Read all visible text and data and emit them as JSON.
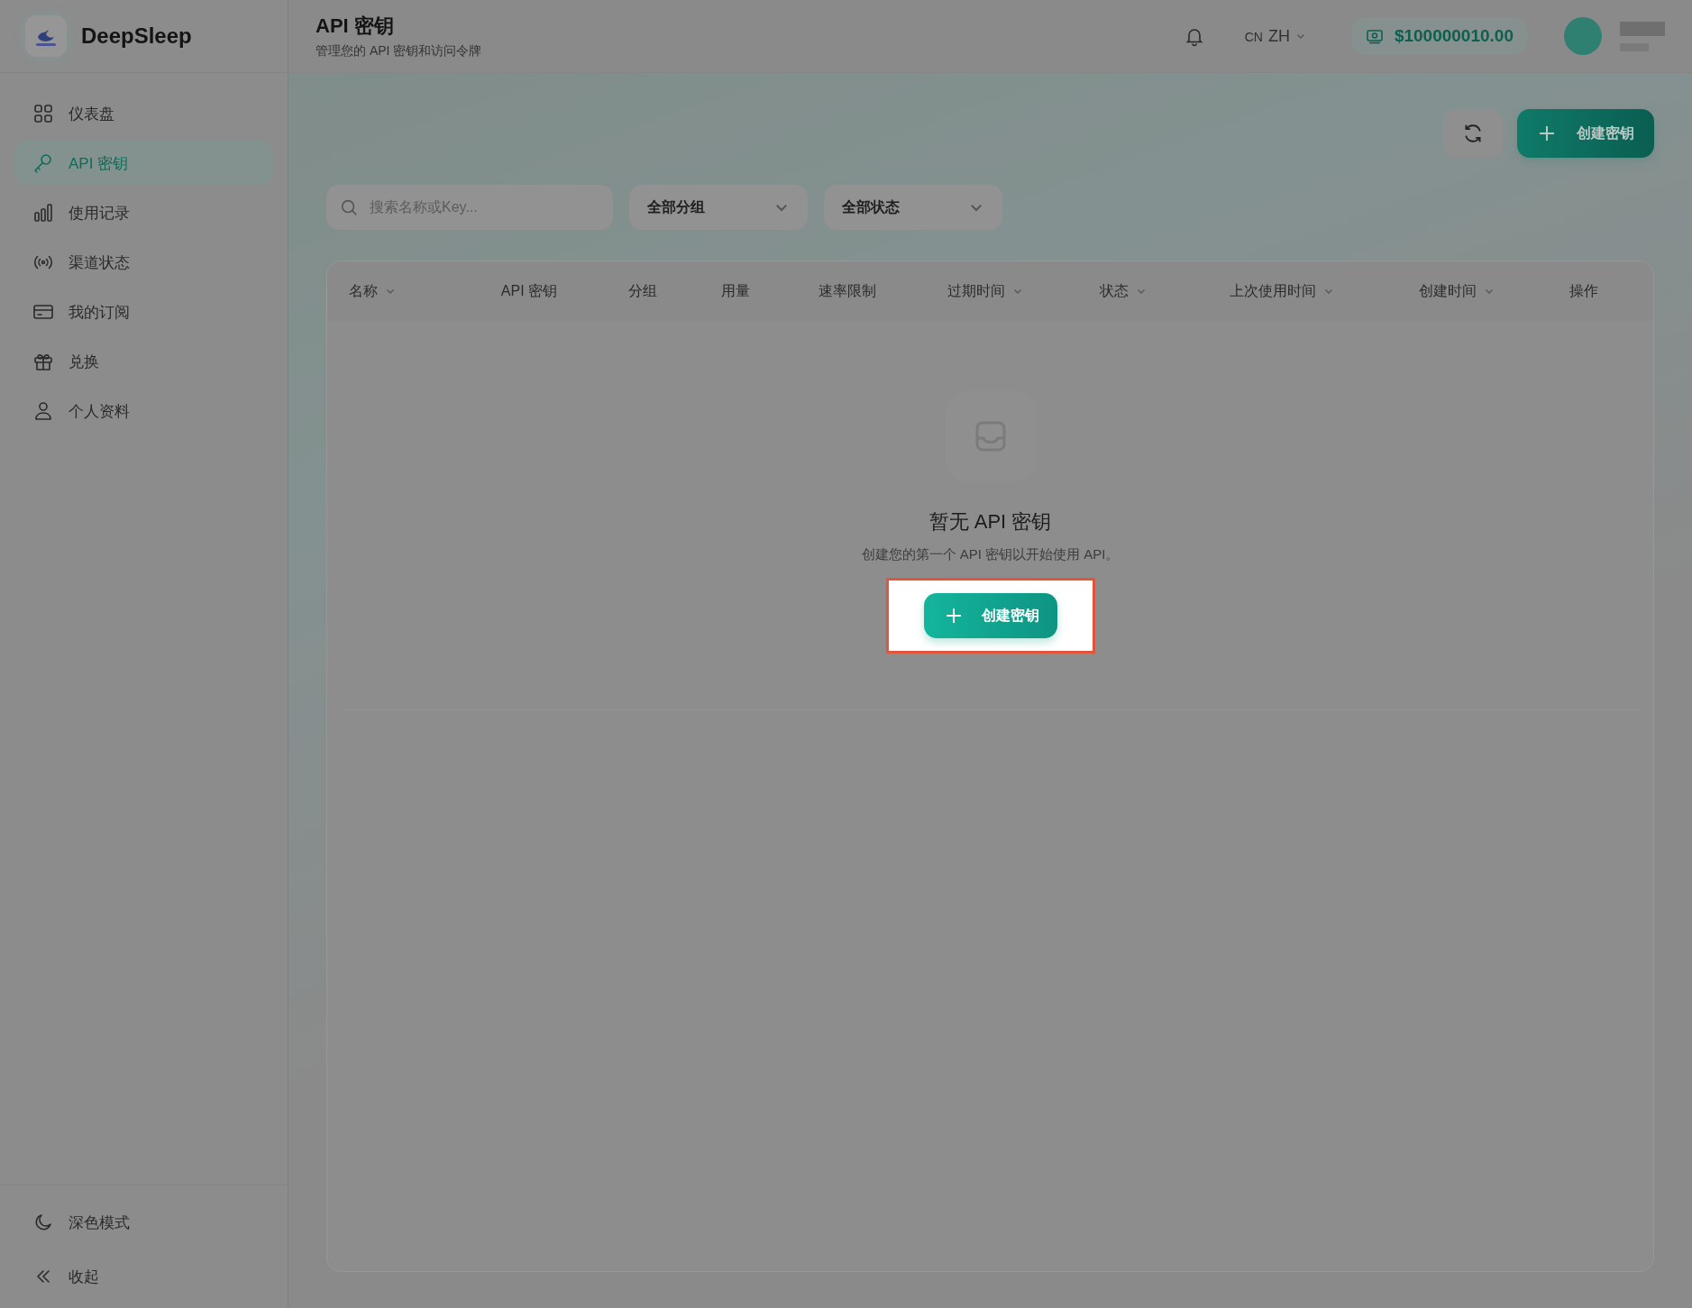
{
  "brand": {
    "name": "DeepSleep"
  },
  "sidebar": {
    "items": [
      {
        "label": "仪表盘",
        "selected": false
      },
      {
        "label": "API 密钥",
        "selected": true
      },
      {
        "label": "使用记录",
        "selected": false
      },
      {
        "label": "渠道状态",
        "selected": false
      },
      {
        "label": "我的订阅",
        "selected": false
      },
      {
        "label": "兑换",
        "selected": false
      },
      {
        "label": "个人资料",
        "selected": false
      }
    ],
    "footer": [
      {
        "label": "深色模式"
      },
      {
        "label": "收起"
      }
    ]
  },
  "header": {
    "title": "API 密钥",
    "subtitle": "管理您的 API 密钥和访问令牌",
    "region": "CN",
    "language": "ZH",
    "balance": "$100000010.00"
  },
  "toolbar": {
    "create_button": "创建密钥"
  },
  "filters": {
    "search": {
      "placeholder": "搜索名称或Key..."
    },
    "dropdowns": [
      "全部分组",
      "全部状态"
    ]
  },
  "table": {
    "columns": [
      {
        "label": "名称",
        "sortable": true
      },
      {
        "label": "API 密钥",
        "sortable": false
      },
      {
        "label": "分组",
        "sortable": false
      },
      {
        "label": "用量",
        "sortable": false
      },
      {
        "label": "速率限制",
        "sortable": false
      },
      {
        "label": "过期时间",
        "sortable": true
      },
      {
        "label": "状态",
        "sortable": true
      },
      {
        "label": "上次使用时间",
        "sortable": true
      },
      {
        "label": "创建时间",
        "sortable": true
      },
      {
        "label": "操作",
        "sortable": false
      }
    ]
  },
  "empty_state": {
    "title": "暂无 API 密钥",
    "description": "创建您的第一个 API 密钥以开始使用 API。",
    "button": "创建密钥",
    "highlighted": true
  }
}
